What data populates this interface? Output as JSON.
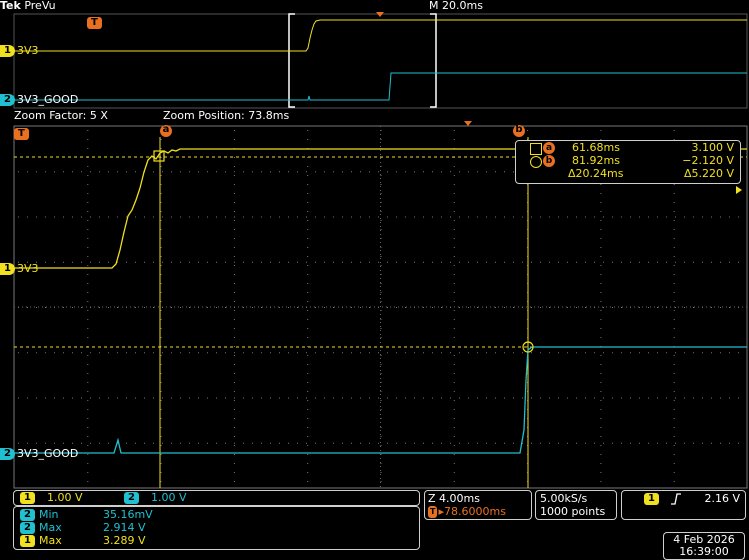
{
  "header": {
    "brand": "Tek",
    "mode": "PreVu",
    "timebase": "M 20.0ms"
  },
  "trigger_marker": "T",
  "zoom": {
    "factor_label": "Zoom Factor: 5 X",
    "position_label": "Zoom Position: 73.8ms"
  },
  "channels": {
    "ch1": {
      "number": "1",
      "name": "3V3",
      "color": "#f0e020"
    },
    "ch2": {
      "number": "2",
      "name": "3V3_GOOD",
      "color": "#20c0d0"
    }
  },
  "cursors": {
    "a_label": "a",
    "b_label": "b",
    "a_time": "61.68ms",
    "a_volt": "3.100 V",
    "b_time": "81.92ms",
    "b_volt": "−2.120 V",
    "delta_time": "Δ20.24ms",
    "delta_volt": "Δ5.220 V"
  },
  "scales": {
    "ch1": "1.00 V",
    "ch2": "1.00 V"
  },
  "measurements": [
    {
      "ch": "2",
      "label": "Min",
      "value": "35.16mV"
    },
    {
      "ch": "2",
      "label": "Max",
      "value": "2.914 V"
    },
    {
      "ch": "1",
      "label": "Max",
      "value": "3.289 V"
    }
  ],
  "horizontal": {
    "zoom_scale": "Z 4.00ms",
    "trigger_pos": "▸78.6000ms"
  },
  "acquisition": {
    "sample_rate": "5.00kS/s",
    "record_length": "1000 points"
  },
  "trigger": {
    "source": "1",
    "slope_icon": "rising-edge-icon",
    "level": "2.16 V"
  },
  "datetime": {
    "date": "4 Feb  2026",
    "time": "16:39:00"
  }
}
